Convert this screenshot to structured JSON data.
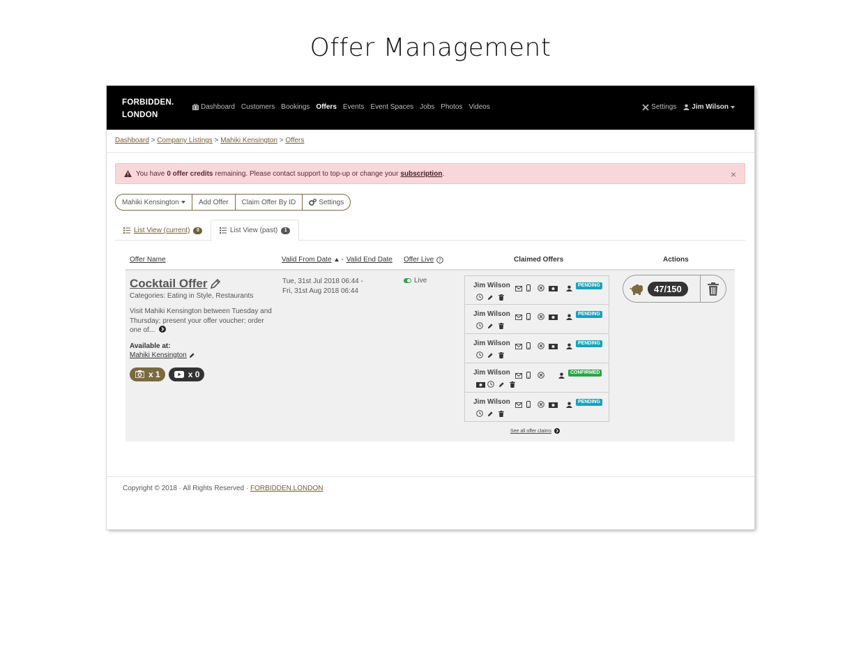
{
  "page_heading": "Offer Management",
  "brand": {
    "line1": "FORBIDDEN.",
    "line2": "LONDON"
  },
  "nav": {
    "items": [
      {
        "label": "Dashboard"
      },
      {
        "label": "Customers"
      },
      {
        "label": "Bookings"
      },
      {
        "label": "Offers"
      },
      {
        "label": "Events"
      },
      {
        "label": "Event Spaces"
      },
      {
        "label": "Jobs"
      },
      {
        "label": "Photos"
      },
      {
        "label": "Videos"
      }
    ],
    "settings": "Settings",
    "user": "Jim Wilson"
  },
  "breadcrumb": {
    "items": [
      "Dashboard",
      "Company Listings",
      "Mahiki Kensington",
      "Offers"
    ],
    "separator": ">"
  },
  "alert": {
    "prefix": "You have",
    "bold": "0 offer credits",
    "middle": "remaining. Please contact support to top-up or change your",
    "link": "subscription",
    "suffix": ".",
    "close": "×"
  },
  "toolbar": {
    "venue_select": "Mahiki Kensington",
    "add_offer": "Add Offer",
    "claim_by_id": "Claim Offer By ID",
    "settings": "Settings"
  },
  "tabs": [
    {
      "label": "List View (current)",
      "count": "0"
    },
    {
      "label": "List View (past)",
      "count": "1"
    }
  ],
  "table": {
    "headers": {
      "offer_name": "Offer Name",
      "valid_from": "Valid From Date",
      "dash": "-",
      "valid_end": "Valid End Date",
      "offer_live": "Offer Live",
      "claimed": "Claimed Offers",
      "actions": "Actions"
    }
  },
  "offer": {
    "title": "Cocktail Offer",
    "categories": "Categories: Eating in Style, Restaurants",
    "description": "Visit Mahiki Kensington between Tuesday and Thursday; present your offer voucher; order one of...",
    "available_label": "Available at:",
    "available_venue": "Mahiki Kensington",
    "photos": "x 1",
    "videos": "x 0",
    "date_start": "Tue, 31st Jul 2018 06:44 -",
    "date_end": "Fri, 31st Aug 2018 06:44",
    "live": "Live",
    "credit": "47/150"
  },
  "claims": [
    {
      "name": "Jim Wilson",
      "status": "PENDING"
    },
    {
      "name": "Jim Wilson",
      "status": "PENDING"
    },
    {
      "name": "Jim Wilson",
      "status": "PENDING"
    },
    {
      "name": "Jim Wilson",
      "status": "CONFIRMED"
    },
    {
      "name": "Jim Wilson",
      "status": "PENDING"
    }
  ],
  "see_all": "See all offer claims",
  "footer": {
    "text": "Copyright © 2018 · All Rights Reserved ·",
    "link": "FORBIDDEN.LONDON"
  },
  "colors": {
    "accent": "#6f5f3a",
    "pending": "#17a2b8",
    "confirmed": "#28a745",
    "alert_bg": "#f8d7da"
  }
}
